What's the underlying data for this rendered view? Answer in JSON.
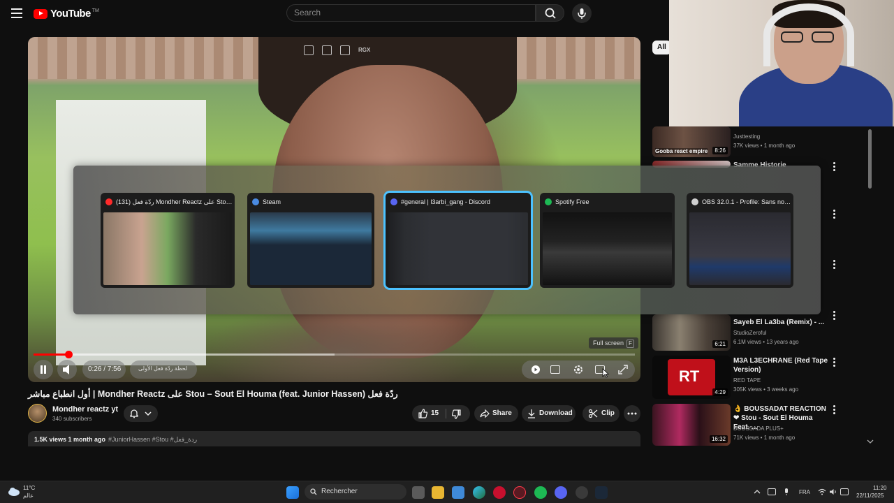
{
  "header": {
    "logo_text": "YouTube",
    "logo_tm": "TM",
    "search_placeholder": "Search"
  },
  "player": {
    "top_icon_rgx": "RGX",
    "time_display": "0:26 / 7:56",
    "chapter": "لحظة ردّة فعل الأولى",
    "progress_fraction": 0.058,
    "buffer_fraction": 0.5,
    "fullscreen_tip": "Full screen",
    "fullscreen_key": "F"
  },
  "switcher": {
    "windows": [
      {
        "title": "(131) ردّة فعل Mondher Reactz على Stou – S...",
        "icon_color": "#ff2a2a",
        "selected": false
      },
      {
        "title": "Steam",
        "icon_color": "#4a8ae0",
        "selected": false
      },
      {
        "title": "#general | l3arbi_gang - Discord",
        "icon_color": "#5865f2",
        "selected": true
      },
      {
        "title": "Spotify Free",
        "icon_color": "#1db954",
        "selected": false
      },
      {
        "title": "OBS 32.0.1 - Profile: Sans nom -...",
        "icon_color": "#cfcfcf",
        "selected": false
      }
    ]
  },
  "video": {
    "title": "أول انطباع مباشر | Mondher Reactz على Stou – Sout El Houma (feat. Junior Hassen) ردّة فعل",
    "channel": "Mondher reactz yt",
    "subscribers": "340 subscribers",
    "likes": "15",
    "share_label": "Share",
    "download_label": "Download",
    "clip_label": "Clip",
    "views_date": "1.5K views  1 month ago",
    "tags": "#JuniorHassen #Stou #ردة_فعل"
  },
  "sidebar": {
    "chip_all": "All",
    "items": [
      {
        "title": "",
        "channel": "Justtesting",
        "meta": "37K views • 1 month ago",
        "duration": "8:26",
        "thumb_label": "Gooba react empire"
      },
      {
        "title": "Samme Historie",
        "channel": "",
        "meta": "",
        "duration": "",
        "thumb_label": ""
      },
      {
        "title": "Sayeb El La3ba (Remix) - ...",
        "channel": "StudioZeroful",
        "meta": "6.1M views • 13 years ago",
        "duration": "6:21",
        "thumb_label": ""
      },
      {
        "title": "M3A L3ECHRANE (Red Tape Version)",
        "channel": "RED TAPE",
        "meta": "305K views • 3 weeks ago",
        "duration": "4:29",
        "thumb_label": "RT"
      },
      {
        "title": "👌 BOUSSADAT REACTION ❤ Stou - Sout El Houma Feat. ...",
        "channel": "BOUSSADA PLUS+",
        "meta": "71K views • 1 month ago",
        "duration": "16:32",
        "thumb_label": ""
      }
    ]
  },
  "taskbar": {
    "weather_temp": "11°C",
    "weather_desc": "عالم",
    "search_label": "Rechercher",
    "lang": "FRA",
    "time": "11:20",
    "date": "22/11/2025"
  }
}
